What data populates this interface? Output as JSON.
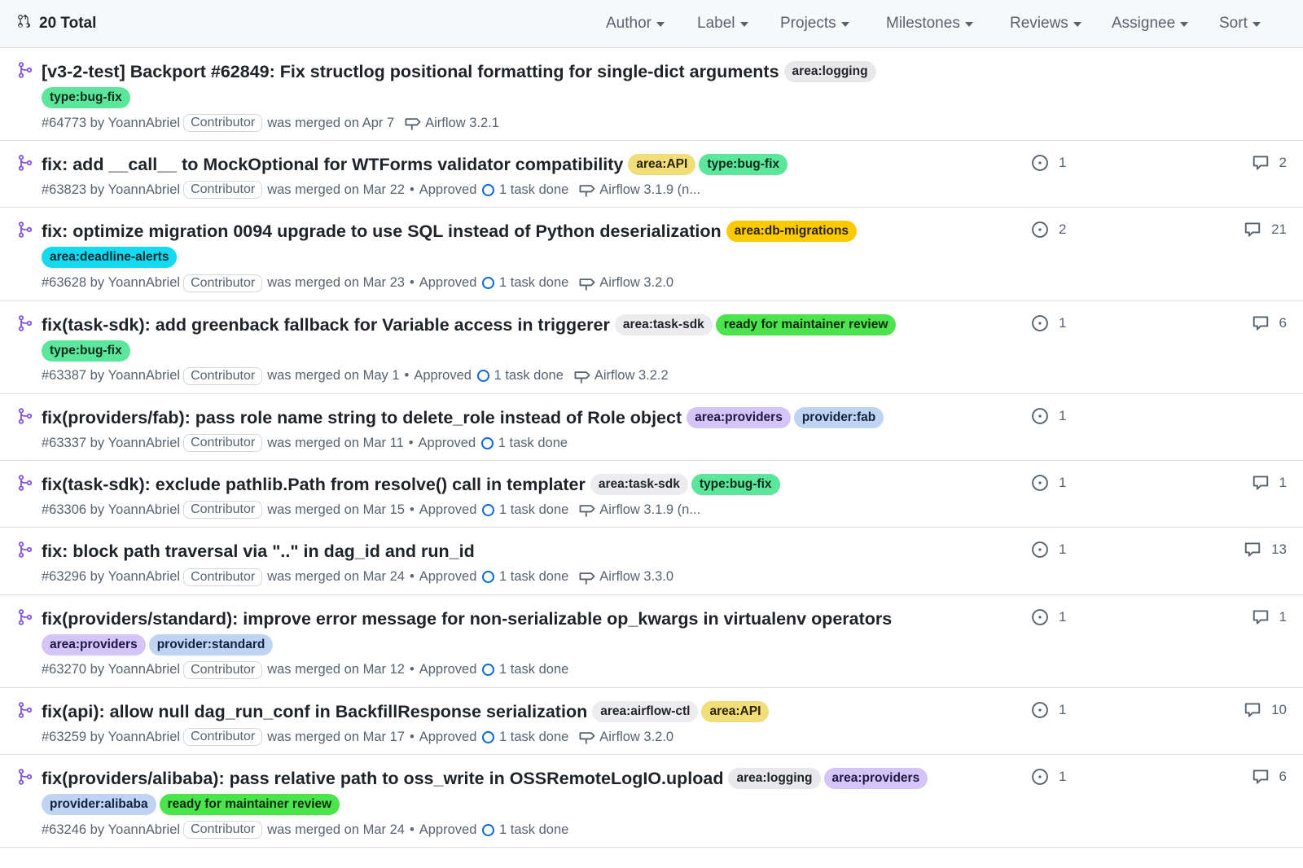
{
  "header": {
    "total": "20 Total",
    "filters": [
      "Author",
      "Label",
      "Projects",
      "Milestones",
      "Reviews",
      "Assignee",
      "Sort"
    ]
  },
  "label_colors": {
    "area:logging": {
      "bg": "#e8e8ea",
      "fg": "#1f2328"
    },
    "type:bug-fix": {
      "bg": "#5ce69b",
      "fg": "#0d2b1b"
    },
    "area:API": {
      "bg": "#f2dd7b",
      "fg": "#2b2400"
    },
    "area:db-migrations": {
      "bg": "#fbca04",
      "fg": "#2b2400"
    },
    "area:deadline-alerts": {
      "bg": "#14d9ef",
      "fg": "#002b30"
    },
    "area:task-sdk": {
      "bg": "#ececef",
      "fg": "#1f2328"
    },
    "ready for maintainer review": {
      "bg": "#4ce44c",
      "fg": "#0b2b0b"
    },
    "area:providers": {
      "bg": "#d4c5f9",
      "fg": "#1f1640"
    },
    "provider:fab": {
      "bg": "#bfd4f2",
      "fg": "#10233f"
    },
    "provider:standard": {
      "bg": "#bfd4f2",
      "fg": "#10233f"
    },
    "area:airflow-ctl": {
      "bg": "#ececef",
      "fg": "#1f2328"
    },
    "provider:alibaba": {
      "bg": "#bfd4f2",
      "fg": "#10233f"
    }
  },
  "prs": [
    {
      "title": "[v3-2-test] Backport #62849: Fix structlog positional formatting for single-dict arguments",
      "labels": [
        "area:logging",
        "type:bug-fix"
      ],
      "wrap_after": 1,
      "number": "#64773",
      "author": "YoannAbriel",
      "role": "Contributor",
      "merged": "was merged on Apr 7",
      "approved": "",
      "tasks": "",
      "milestone": "Airflow 3.2.1",
      "issues": "",
      "comments": ""
    },
    {
      "title": "fix: add __call__ to MockOptional for WTForms validator compatibility",
      "labels": [
        "area:API",
        "type:bug-fix"
      ],
      "wrap_after": 99,
      "number": "#63823",
      "author": "YoannAbriel",
      "role": "Contributor",
      "merged": "was merged on Mar 22",
      "approved": "Approved",
      "tasks": "1 task done",
      "milestone": "Airflow 3.1.9 (n...",
      "issues": "1",
      "comments": "2"
    },
    {
      "title": "fix: optimize migration 0094 upgrade to use SQL instead of Python deserialization",
      "labels": [
        "area:db-migrations",
        "area:deadline-alerts"
      ],
      "wrap_after": 1,
      "number": "#63628",
      "author": "YoannAbriel",
      "role": "Contributor",
      "merged": "was merged on Mar 23",
      "approved": "Approved",
      "tasks": "1 task done",
      "milestone": "Airflow 3.2.0",
      "issues": "2",
      "comments": "21"
    },
    {
      "title": "fix(task-sdk): add greenback fallback for Variable access in triggerer",
      "labels": [
        "area:task-sdk",
        "ready for maintainer review",
        "type:bug-fix"
      ],
      "wrap_after": 2,
      "number": "#63387",
      "author": "YoannAbriel",
      "role": "Contributor",
      "merged": "was merged on May 1",
      "approved": "Approved",
      "tasks": "1 task done",
      "milestone": "Airflow 3.2.2",
      "issues": "1",
      "comments": "6"
    },
    {
      "title": "fix(providers/fab): pass role name string to delete_role instead of Role object",
      "labels": [
        "area:providers",
        "provider:fab"
      ],
      "wrap_after": 99,
      "number": "#63337",
      "author": "YoannAbriel",
      "role": "Contributor",
      "merged": "was merged on Mar 11",
      "approved": "Approved",
      "tasks": "1 task done",
      "milestone": "",
      "issues": "1",
      "comments": ""
    },
    {
      "title": "fix(task-sdk): exclude pathlib.Path from resolve() call in templater",
      "labels": [
        "area:task-sdk",
        "type:bug-fix"
      ],
      "wrap_after": 99,
      "number": "#63306",
      "author": "YoannAbriel",
      "role": "Contributor",
      "merged": "was merged on Mar 15",
      "approved": "Approved",
      "tasks": "1 task done",
      "milestone": "Airflow 3.1.9 (n...",
      "issues": "1",
      "comments": "1"
    },
    {
      "title": "fix: block path traversal via \"..\" in dag_id and run_id",
      "labels": [],
      "wrap_after": 99,
      "number": "#63296",
      "author": "YoannAbriel",
      "role": "Contributor",
      "merged": "was merged on Mar 24",
      "approved": "Approved",
      "tasks": "1 task done",
      "milestone": "Airflow 3.3.0",
      "issues": "1",
      "comments": "13"
    },
    {
      "title": "fix(providers/standard): improve error message for non-serializable op_kwargs in virtualenv operators",
      "labels": [
        "area:providers",
        "provider:standard"
      ],
      "wrap_after": 0,
      "number": "#63270",
      "author": "YoannAbriel",
      "role": "Contributor",
      "merged": "was merged on Mar 12",
      "approved": "Approved",
      "tasks": "1 task done",
      "milestone": "",
      "issues": "1",
      "comments": "1"
    },
    {
      "title": "fix(api): allow null dag_run_conf in BackfillResponse serialization",
      "labels": [
        "area:airflow-ctl",
        "area:API"
      ],
      "wrap_after": 99,
      "number": "#63259",
      "author": "YoannAbriel",
      "role": "Contributor",
      "merged": "was merged on Mar 17",
      "approved": "Approved",
      "tasks": "1 task done",
      "milestone": "Airflow 3.2.0",
      "issues": "1",
      "comments": "10"
    },
    {
      "title": "fix(providers/alibaba): pass relative path to oss_write in OSSRemoteLogIO.upload",
      "labels": [
        "area:logging",
        "area:providers",
        "provider:alibaba",
        "ready for maintainer review"
      ],
      "wrap_after": 2,
      "number": "#63246",
      "author": "YoannAbriel",
      "role": "Contributor",
      "merged": "was merged on Mar 24",
      "approved": "Approved",
      "tasks": "1 task done",
      "milestone": "",
      "issues": "1",
      "comments": "6"
    }
  ]
}
